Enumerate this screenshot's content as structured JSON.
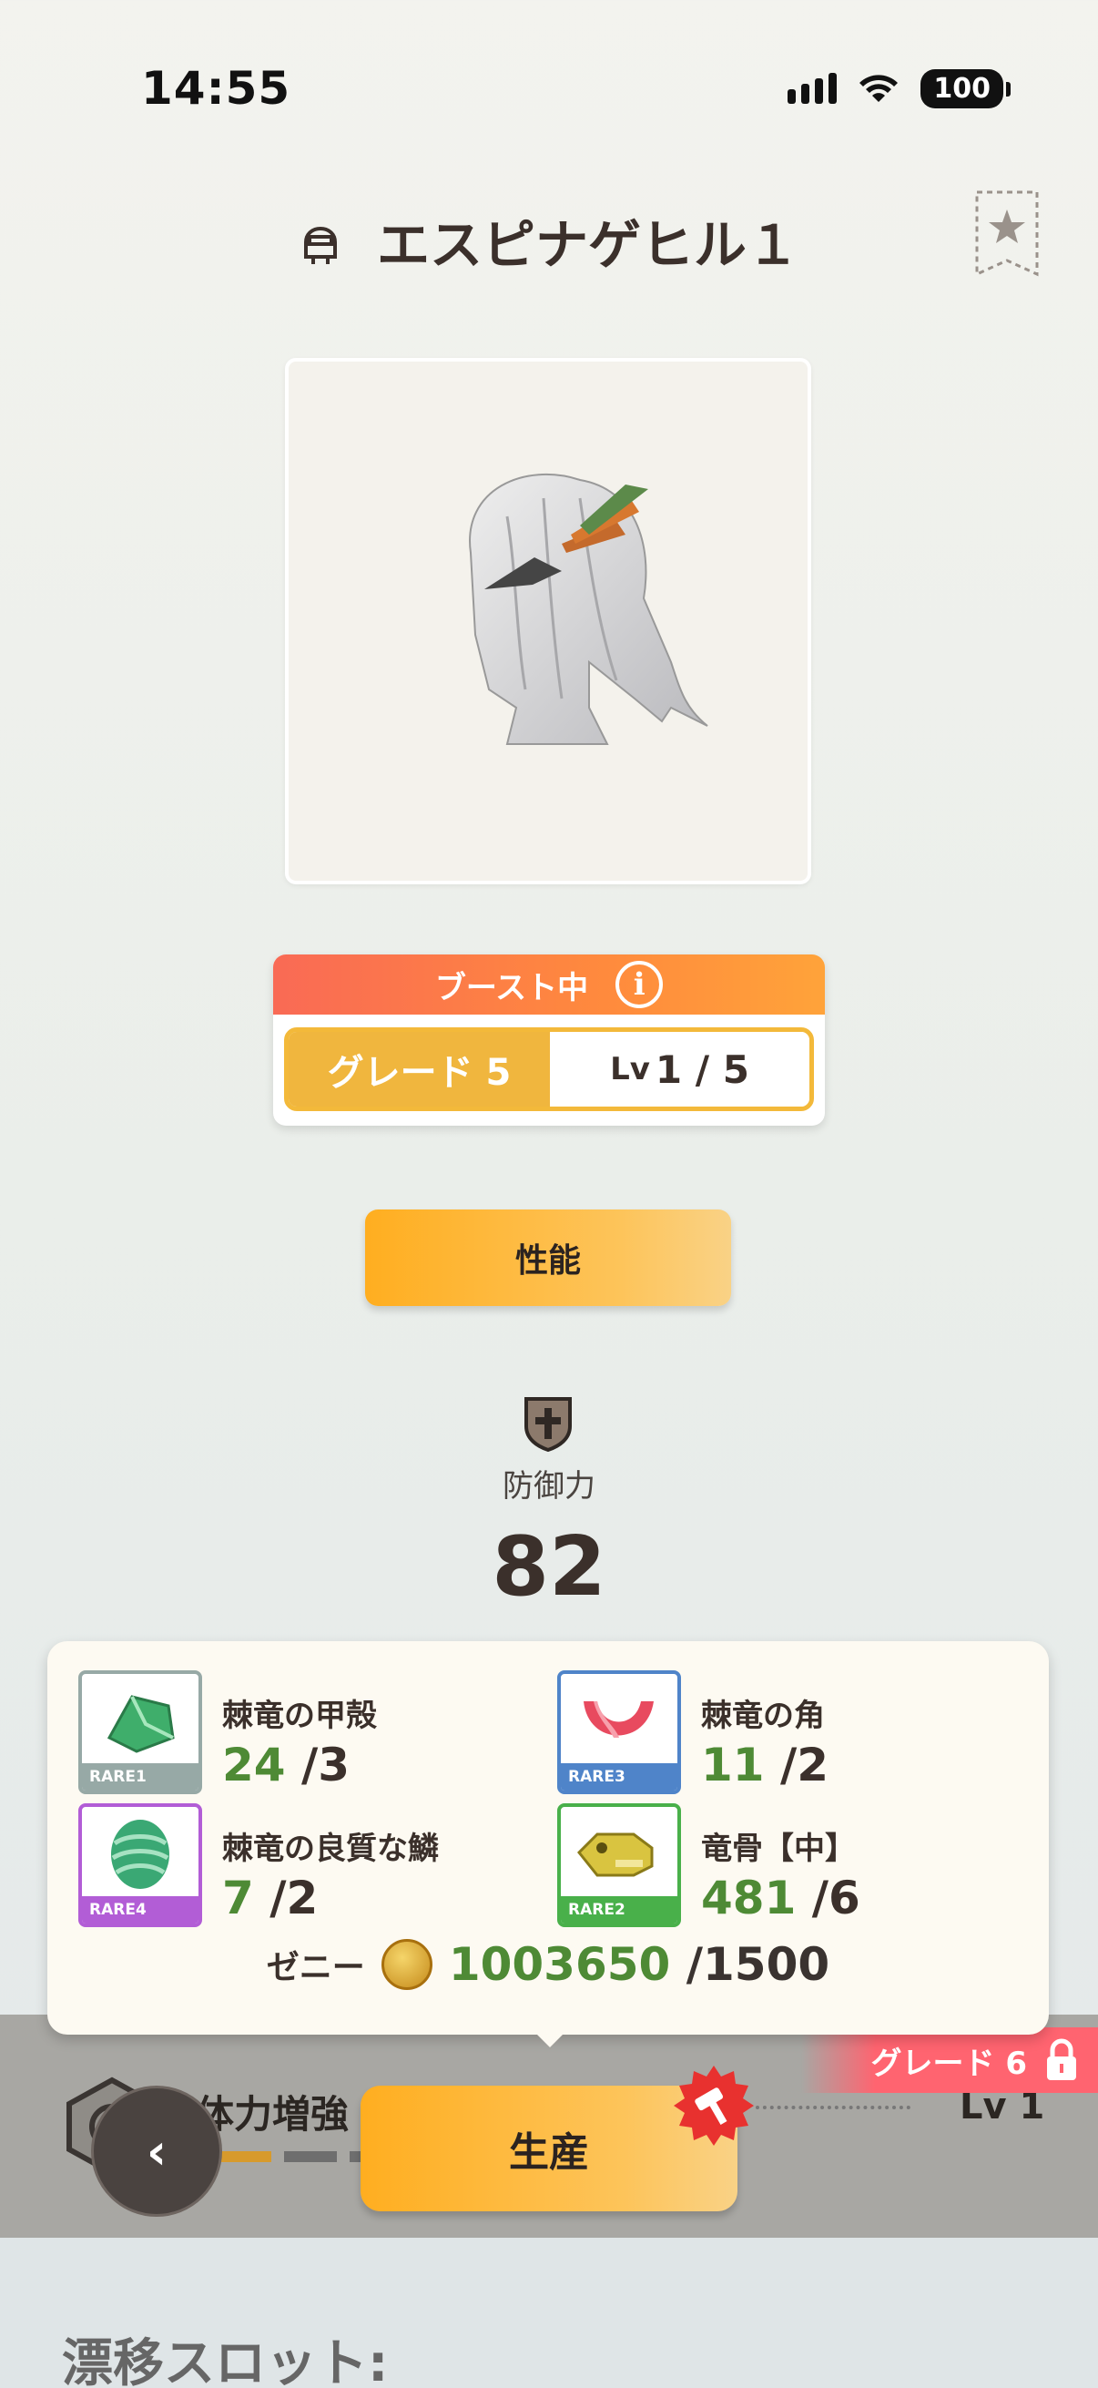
{
  "status_bar": {
    "time": "14:55",
    "battery": "100"
  },
  "header": {
    "title": "エスピナゲヒル１"
  },
  "boost": {
    "label": "ブースト中",
    "grade_label": "グレード 5",
    "lv_prefix": "Lv",
    "lv_value": "1 / 5"
  },
  "buttons": {
    "performance": "性能",
    "produce": "生産",
    "back": "‹"
  },
  "defense": {
    "label": "防御力",
    "value": "82"
  },
  "materials": [
    {
      "name": "棘竜の甲殻",
      "have": "24",
      "need": " /3",
      "rarity": "RARE1",
      "rarity_color": "#97a9a6",
      "icon": "green-shell-icon"
    },
    {
      "name": "棘竜の角",
      "have": "11",
      "need": " /2",
      "rarity": "RARE3",
      "rarity_color": "#4f84c9",
      "icon": "red-horn-icon"
    },
    {
      "name": "棘竜の良質な鱗",
      "have": "7",
      "need": " /2",
      "rarity": "RARE4",
      "rarity_color": "#b25dd6",
      "icon": "green-scale-icon"
    },
    {
      "name": "竜骨【中】",
      "have": "481",
      "need": " /6",
      "rarity": "RARE2",
      "rarity_color": "#49b04a",
      "icon": "bone-icon"
    }
  ],
  "zeny": {
    "label": "ゼニー",
    "have": "1003650",
    "need": " /1500"
  },
  "skill": {
    "name": "体力増強",
    "level": "Lv 1",
    "locked_grade": "グレード 6",
    "progress_filled": 1,
    "progress_total": 3
  },
  "slots": {
    "title": "漂移スロット:"
  },
  "colors": {
    "accent_orange": "#ffae20",
    "boost_red": "#f96a55",
    "have_green": "#4e8a35"
  }
}
